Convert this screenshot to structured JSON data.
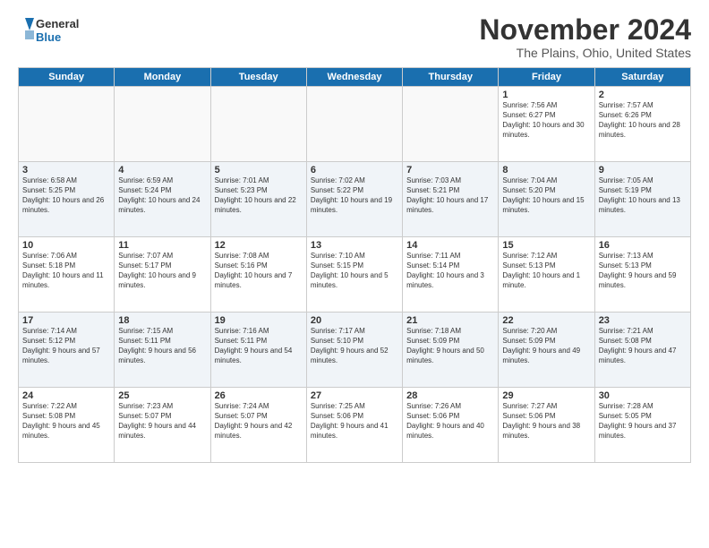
{
  "logo": {
    "general": "General",
    "blue": "Blue"
  },
  "title": "November 2024",
  "location": "The Plains, Ohio, United States",
  "weekdays": [
    "Sunday",
    "Monday",
    "Tuesday",
    "Wednesday",
    "Thursday",
    "Friday",
    "Saturday"
  ],
  "weeks": [
    [
      {
        "day": "",
        "info": ""
      },
      {
        "day": "",
        "info": ""
      },
      {
        "day": "",
        "info": ""
      },
      {
        "day": "",
        "info": ""
      },
      {
        "day": "",
        "info": ""
      },
      {
        "day": "1",
        "info": "Sunrise: 7:56 AM\nSunset: 6:27 PM\nDaylight: 10 hours and 30 minutes."
      },
      {
        "day": "2",
        "info": "Sunrise: 7:57 AM\nSunset: 6:26 PM\nDaylight: 10 hours and 28 minutes."
      }
    ],
    [
      {
        "day": "3",
        "info": "Sunrise: 6:58 AM\nSunset: 5:25 PM\nDaylight: 10 hours and 26 minutes."
      },
      {
        "day": "4",
        "info": "Sunrise: 6:59 AM\nSunset: 5:24 PM\nDaylight: 10 hours and 24 minutes."
      },
      {
        "day": "5",
        "info": "Sunrise: 7:01 AM\nSunset: 5:23 PM\nDaylight: 10 hours and 22 minutes."
      },
      {
        "day": "6",
        "info": "Sunrise: 7:02 AM\nSunset: 5:22 PM\nDaylight: 10 hours and 19 minutes."
      },
      {
        "day": "7",
        "info": "Sunrise: 7:03 AM\nSunset: 5:21 PM\nDaylight: 10 hours and 17 minutes."
      },
      {
        "day": "8",
        "info": "Sunrise: 7:04 AM\nSunset: 5:20 PM\nDaylight: 10 hours and 15 minutes."
      },
      {
        "day": "9",
        "info": "Sunrise: 7:05 AM\nSunset: 5:19 PM\nDaylight: 10 hours and 13 minutes."
      }
    ],
    [
      {
        "day": "10",
        "info": "Sunrise: 7:06 AM\nSunset: 5:18 PM\nDaylight: 10 hours and 11 minutes."
      },
      {
        "day": "11",
        "info": "Sunrise: 7:07 AM\nSunset: 5:17 PM\nDaylight: 10 hours and 9 minutes."
      },
      {
        "day": "12",
        "info": "Sunrise: 7:08 AM\nSunset: 5:16 PM\nDaylight: 10 hours and 7 minutes."
      },
      {
        "day": "13",
        "info": "Sunrise: 7:10 AM\nSunset: 5:15 PM\nDaylight: 10 hours and 5 minutes."
      },
      {
        "day": "14",
        "info": "Sunrise: 7:11 AM\nSunset: 5:14 PM\nDaylight: 10 hours and 3 minutes."
      },
      {
        "day": "15",
        "info": "Sunrise: 7:12 AM\nSunset: 5:13 PM\nDaylight: 10 hours and 1 minute."
      },
      {
        "day": "16",
        "info": "Sunrise: 7:13 AM\nSunset: 5:13 PM\nDaylight: 9 hours and 59 minutes."
      }
    ],
    [
      {
        "day": "17",
        "info": "Sunrise: 7:14 AM\nSunset: 5:12 PM\nDaylight: 9 hours and 57 minutes."
      },
      {
        "day": "18",
        "info": "Sunrise: 7:15 AM\nSunset: 5:11 PM\nDaylight: 9 hours and 56 minutes."
      },
      {
        "day": "19",
        "info": "Sunrise: 7:16 AM\nSunset: 5:11 PM\nDaylight: 9 hours and 54 minutes."
      },
      {
        "day": "20",
        "info": "Sunrise: 7:17 AM\nSunset: 5:10 PM\nDaylight: 9 hours and 52 minutes."
      },
      {
        "day": "21",
        "info": "Sunrise: 7:18 AM\nSunset: 5:09 PM\nDaylight: 9 hours and 50 minutes."
      },
      {
        "day": "22",
        "info": "Sunrise: 7:20 AM\nSunset: 5:09 PM\nDaylight: 9 hours and 49 minutes."
      },
      {
        "day": "23",
        "info": "Sunrise: 7:21 AM\nSunset: 5:08 PM\nDaylight: 9 hours and 47 minutes."
      }
    ],
    [
      {
        "day": "24",
        "info": "Sunrise: 7:22 AM\nSunset: 5:08 PM\nDaylight: 9 hours and 45 minutes."
      },
      {
        "day": "25",
        "info": "Sunrise: 7:23 AM\nSunset: 5:07 PM\nDaylight: 9 hours and 44 minutes."
      },
      {
        "day": "26",
        "info": "Sunrise: 7:24 AM\nSunset: 5:07 PM\nDaylight: 9 hours and 42 minutes."
      },
      {
        "day": "27",
        "info": "Sunrise: 7:25 AM\nSunset: 5:06 PM\nDaylight: 9 hours and 41 minutes."
      },
      {
        "day": "28",
        "info": "Sunrise: 7:26 AM\nSunset: 5:06 PM\nDaylight: 9 hours and 40 minutes."
      },
      {
        "day": "29",
        "info": "Sunrise: 7:27 AM\nSunset: 5:06 PM\nDaylight: 9 hours and 38 minutes."
      },
      {
        "day": "30",
        "info": "Sunrise: 7:28 AM\nSunset: 5:05 PM\nDaylight: 9 hours and 37 minutes."
      }
    ]
  ]
}
